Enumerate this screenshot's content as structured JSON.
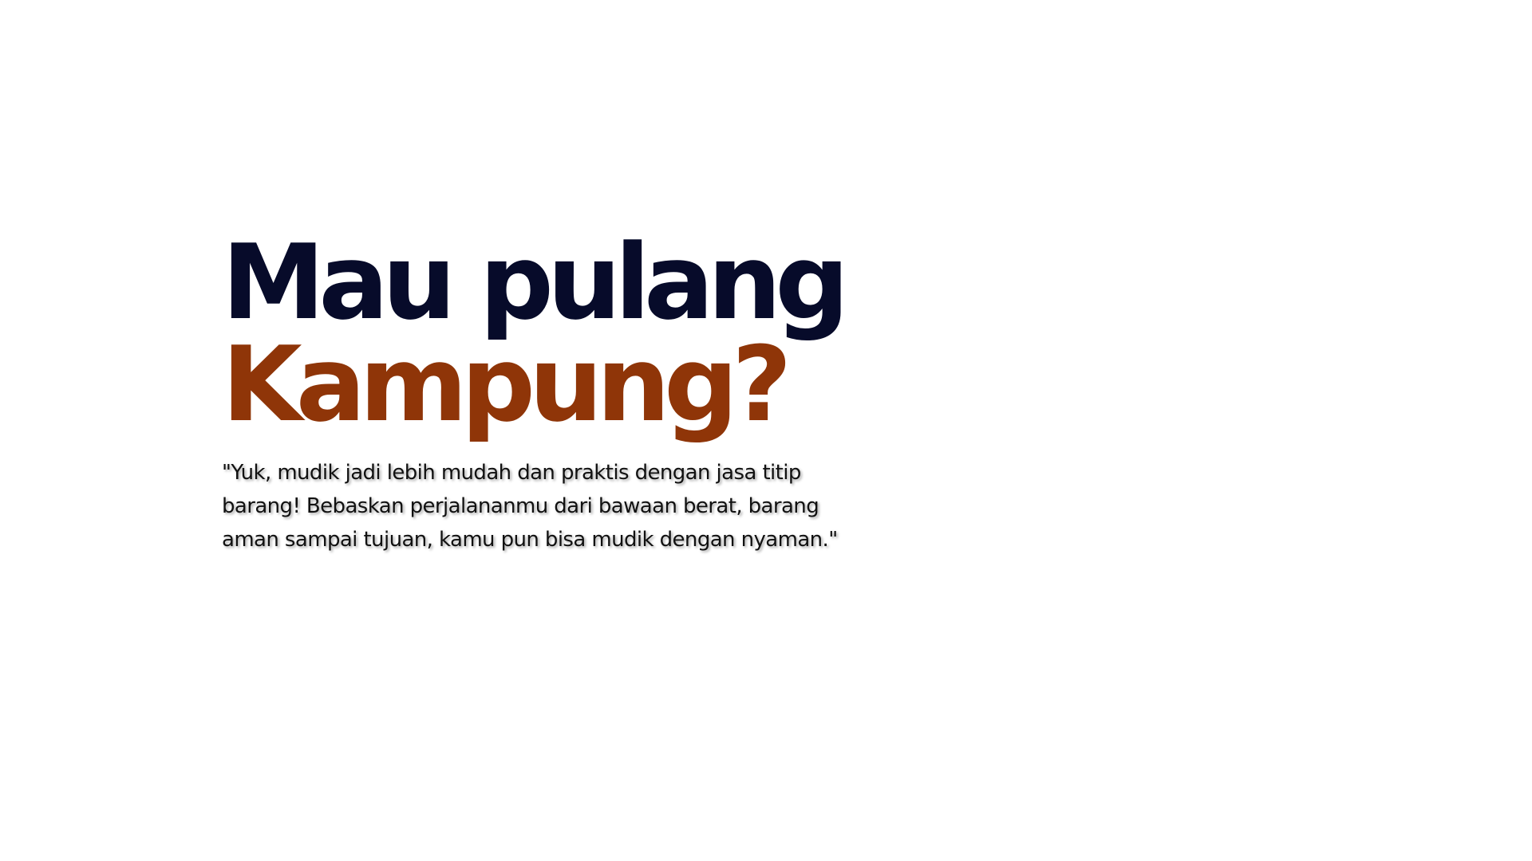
{
  "hero": {
    "headline_line1": "Mau pulang",
    "headline_line2": "Kampung?",
    "tagline": "\"Yuk, mudik jadi lebih mudah dan praktis dengan jasa titip barang! Bebaskan perjalananmu dari bawaan berat, barang aman sampai tujuan, kamu pun bisa mudik dengan nyaman.\""
  },
  "colors": {
    "headline_primary": "#070b2a",
    "headline_accent": "#8f3508",
    "body_text": "#111111",
    "background": "#ffffff"
  }
}
